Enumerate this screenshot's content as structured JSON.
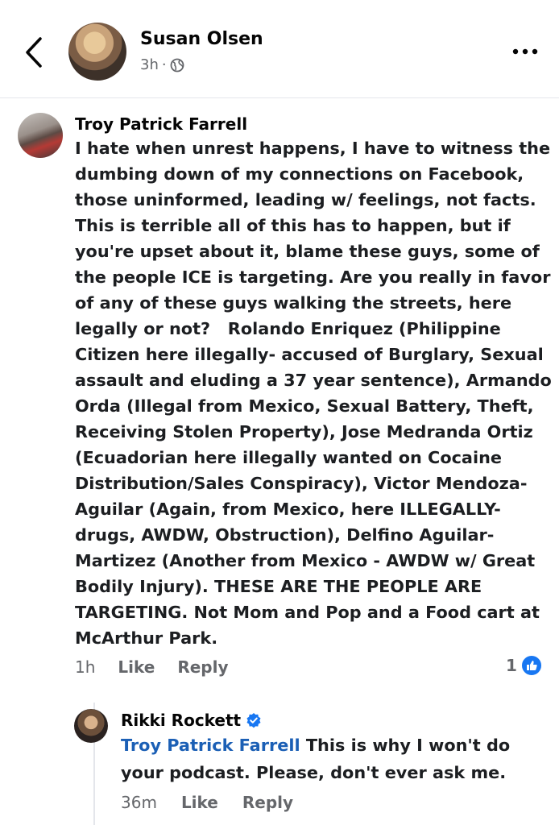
{
  "header": {
    "name": "Susan Olsen",
    "time": "3h",
    "separator": "·",
    "icons": {
      "back": "chevron-left-icon",
      "privacy": "globe-icon",
      "more": "more-dots-icon"
    }
  },
  "comment": {
    "author": "Troy Patrick Farrell",
    "text": "I hate when unrest happens, I have to witness the dumbing down of my connections on Facebook, those uninformed, leading w/ feelings, not facts. This is terrible all of this has to happen, but if you're upset about it, blame these guys, some of the people ICE is targeting. Are you really in favor of any of these guys walking the streets, here legally or not?   Rolando Enriquez (Philippine Citizen here illegally- accused of Burglary, Sexual assault and eluding a 37 year sentence), Armando Orda (Illegal from Mexico, Sexual Battery, Theft, Receiving Stolen Property), Jose Medranda Ortiz (Ecuadorian here illegally wanted on Cocaine Distribution/Sales Conspiracy), Victor Mendoza-Aguilar (Again, from Mexico, here ILLEGALLY- drugs, AWDW, Obstruction), Delfino Aguilar-Martizez (Another from Mexico - AWDW w/ Great Bodily Injury). THESE ARE THE PEOPLE ARE TARGETING. Not Mom and Pop and a Food cart at McArthur Park.",
    "time": "1h",
    "like_label": "Like",
    "reply_label": "Reply",
    "reaction_count": "1",
    "reaction_color": "#1877f2"
  },
  "reply": {
    "author": "Rikki Rockett",
    "mention": "Troy Patrick Farrell",
    "text": " This is why I won't do your podcast. Please, don't ever ask me.",
    "time": "36m",
    "like_label": "Like",
    "reply_label": "Reply",
    "mention_color": "#1b5fb5",
    "verified_color": "#1877f2"
  }
}
